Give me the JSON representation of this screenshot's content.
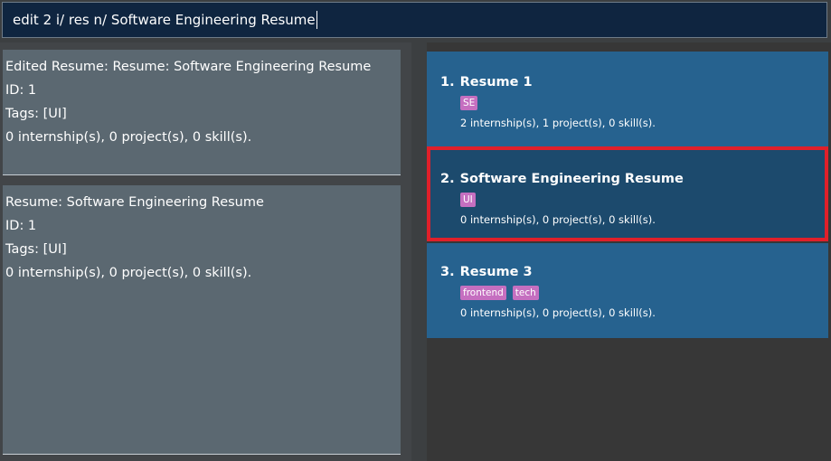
{
  "command": {
    "value": "edit 2 i/ res n/ Software Engineering Resume"
  },
  "feedback": {
    "lines": [
      "Edited Resume: Resume: Software Engineering Resume",
      "ID: 1",
      "Tags: [UI]",
      "0 internship(s), 0 project(s), 0 skill(s)."
    ]
  },
  "detail": {
    "lines": [
      "Resume: Software Engineering Resume",
      "ID: 1",
      "Tags: [UI]",
      "0 internship(s), 0 project(s), 0 skill(s)."
    ]
  },
  "resume_list": {
    "items": [
      {
        "index": "1.",
        "name": "Resume 1",
        "tags": [
          "SE"
        ],
        "stats": "2 internship(s), 1 project(s), 0 skill(s).",
        "selected": false
      },
      {
        "index": "2.",
        "name": "Software Engineering Resume",
        "tags": [
          "UI"
        ],
        "stats": "0 internship(s), 0 project(s), 0 skill(s).",
        "selected": true
      },
      {
        "index": "3.",
        "name": "Resume 3",
        "tags": [
          "frontend",
          "tech"
        ],
        "stats": "0 internship(s), 0 project(s), 0 skill(s).",
        "selected": false
      }
    ]
  },
  "colors": {
    "card_bg": "#26628f",
    "card_selected_bg": "#1c4a6d",
    "selection_border": "#e0202a",
    "tag_bg": "#c56fc0",
    "panel_bg": "#5b6871",
    "command_bg": "#0f2540"
  }
}
